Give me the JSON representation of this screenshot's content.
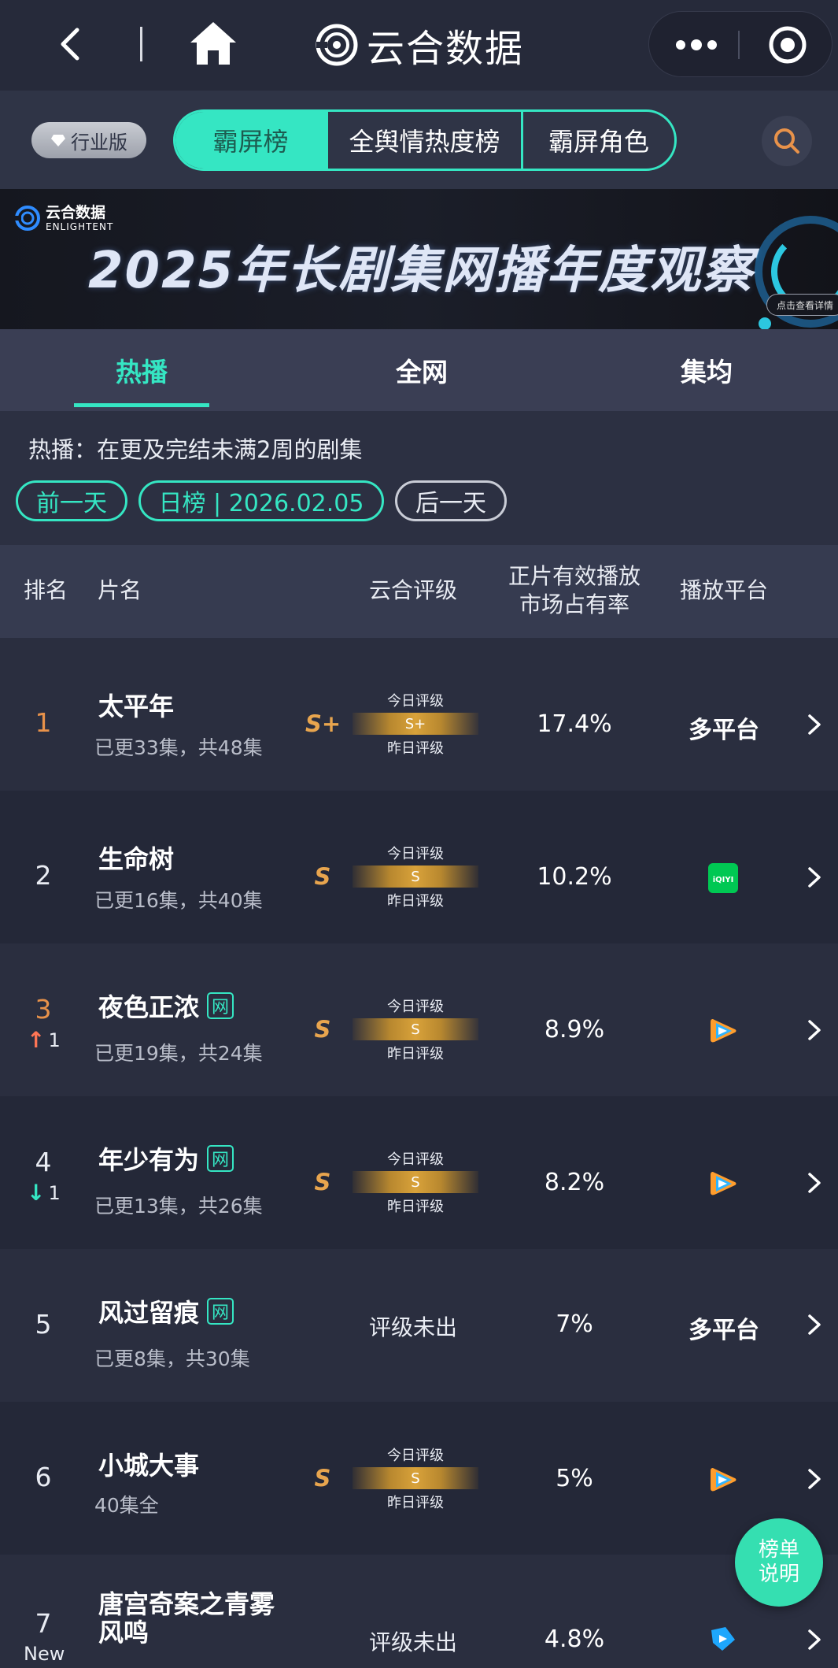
{
  "brand": {
    "name": "云合数据"
  },
  "topnav": {
    "icons": [
      "back-arrow-icon",
      "home-icon",
      "more-dots-icon",
      "close-target-icon"
    ]
  },
  "tabbar": {
    "industry_badge": "行业版",
    "tabs": [
      {
        "label": "霸屏榜",
        "active": true
      },
      {
        "label": "全舆情热度榜",
        "active": false
      },
      {
        "label": "霸屏角色",
        "active": false
      }
    ],
    "search_icon": "search-icon"
  },
  "banner": {
    "logo_cn": "云合数据",
    "logo_en": "ENLIGHTENT",
    "title": "2025年长剧集网播年度观察",
    "detail_button": "点击查看详情"
  },
  "subtabs": [
    {
      "label": "热播",
      "active": true
    },
    {
      "label": "全网",
      "active": false
    },
    {
      "label": "集均",
      "active": false
    }
  ],
  "filter": {
    "description": "热播：在更及完结未满2周的剧集",
    "prev_day": "前一天",
    "date_pill": "日榜 | 2026.02.05",
    "next_day": "后一天"
  },
  "table": {
    "headers": {
      "rank": "排名",
      "title": "片名",
      "grade": "云合评级",
      "share_line1": "正片有效播放",
      "share_line2": "市场占有率",
      "platform": "播放平台"
    },
    "grade_today_label": "今日评级",
    "grade_yesterday_label": "昨日评级",
    "rows": [
      {
        "rank": "1",
        "title": "太平年",
        "net": false,
        "episodes": "已更33集，共48集",
        "grade": "S+",
        "grade_bar": "S+",
        "share": "17.4%",
        "platform": "多平台",
        "platform_icon": "",
        "change": "",
        "change_dir": ""
      },
      {
        "rank": "2",
        "title": "生命树",
        "net": false,
        "episodes": "已更16集，共40集",
        "grade": "S",
        "grade_bar": "S",
        "share": "10.2%",
        "platform": "",
        "platform_icon": "iqiyi-icon",
        "change": "",
        "change_dir": ""
      },
      {
        "rank": "3",
        "title": "夜色正浓",
        "net": true,
        "episodes": "已更19集，共24集",
        "grade": "S",
        "grade_bar": "S",
        "share": "8.9%",
        "platform": "",
        "platform_icon": "tencent-video-icon",
        "change": "1",
        "change_dir": "up"
      },
      {
        "rank": "4",
        "title": "年少有为",
        "net": true,
        "episodes": "已更13集，共26集",
        "grade": "S",
        "grade_bar": "S",
        "share": "8.2%",
        "platform": "",
        "platform_icon": "tencent-video-icon",
        "change": "1",
        "change_dir": "down"
      },
      {
        "rank": "5",
        "title": "风过留痕",
        "net": true,
        "episodes": "已更8集，共30集",
        "grade": "",
        "grade_pending": "评级未出",
        "share": "7%",
        "platform": "多平台",
        "platform_icon": "",
        "change": "",
        "change_dir": ""
      },
      {
        "rank": "6",
        "title": "小城大事",
        "net": false,
        "episodes": "40集全",
        "grade": "S",
        "grade_bar": "S",
        "share": "5%",
        "platform": "",
        "platform_icon": "tencent-video-icon",
        "change": "",
        "change_dir": ""
      },
      {
        "rank": "7",
        "title_line1": "唐宫奇案之青雾",
        "title_line2": "风鸣",
        "net": false,
        "episodes": "",
        "grade": "",
        "grade_pending": "评级未出",
        "share": "4.8%",
        "platform": "",
        "platform_icon": "youku-icon",
        "change": "New",
        "change_dir": "new"
      }
    ],
    "net_tag": "网"
  },
  "float_button": {
    "line1": "榜单",
    "line2": "说明"
  },
  "colors": {
    "accent": "#35e6c3",
    "rank_top": "#e8924a",
    "grade_gold": "#d9a23a",
    "up": "#ff7555",
    "background": "#262a3a"
  }
}
